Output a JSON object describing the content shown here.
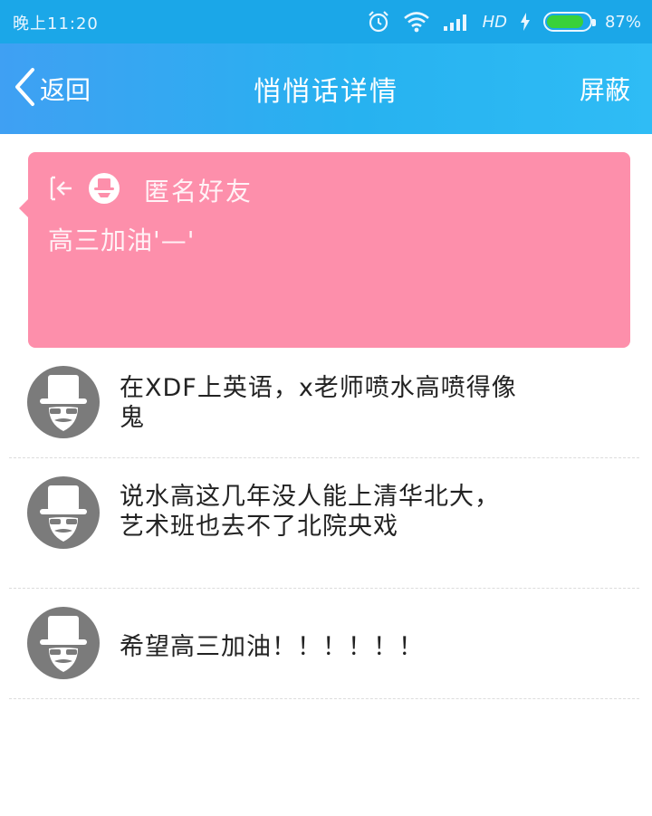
{
  "status_bar": {
    "time": "晚上11:20",
    "network": "HD",
    "battery": "87%",
    "battery_level": 0.87
  },
  "header": {
    "back_label": "返回",
    "title": "悄悄话详情",
    "action_label": "屏蔽"
  },
  "message": {
    "sender": "匿名好友",
    "text": "高三加油'—'"
  },
  "comments": [
    {
      "text": "在XDF上英语，x老师喷水高喷得像鬼"
    },
    {
      "text": "说水高这几年没人能上清华北大，艺术班也去不了北院央戏"
    },
    {
      "text": "希望高三加油！！！！！！"
    }
  ],
  "colors": {
    "status_bar": "#1ba7e8",
    "header_gradient_start": "#3fa0f3",
    "header_gradient_end": "#2fbcf5",
    "card": "#fd8fab",
    "avatar": "#7b7b7b"
  }
}
